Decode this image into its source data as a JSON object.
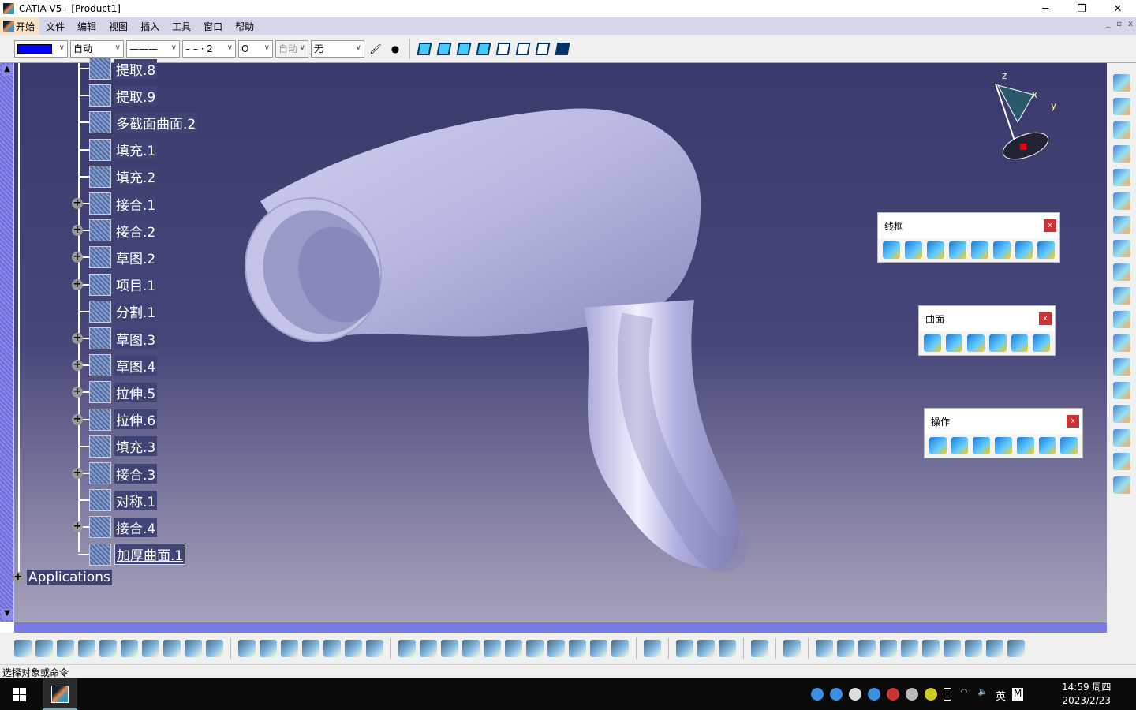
{
  "window": {
    "title": "CATIA V5 - [Product1]",
    "minimize": "─",
    "restore": "❐",
    "close": "✕"
  },
  "menu": {
    "items": [
      "开始",
      "文件",
      "编辑",
      "视图",
      "插入",
      "工具",
      "窗口",
      "帮助"
    ],
    "mdi": [
      "_",
      "▫",
      "x"
    ]
  },
  "toolbar": {
    "color": "#0000ff",
    "transparency": "自动",
    "linetype": "———",
    "lineweight": "– – · 2",
    "point": "O",
    "layer_auto": "自动",
    "layer": "无"
  },
  "tree": {
    "items": [
      {
        "label": "提取.8",
        "expand": false
      },
      {
        "label": "提取.9",
        "expand": false
      },
      {
        "label": "多截面曲面.2",
        "expand": false
      },
      {
        "label": "填充.1",
        "expand": false
      },
      {
        "label": "填充.2",
        "expand": false
      },
      {
        "label": "接合.1",
        "expand": true
      },
      {
        "label": "接合.2",
        "expand": true
      },
      {
        "label": "草图.2",
        "expand": true
      },
      {
        "label": "项目.1",
        "expand": true
      },
      {
        "label": "分割.1",
        "expand": false
      },
      {
        "label": "草图.3",
        "expand": true
      },
      {
        "label": "草图.4",
        "expand": true
      },
      {
        "label": "拉伸.5",
        "expand": true
      },
      {
        "label": "拉伸.6",
        "expand": true
      },
      {
        "label": "填充.3",
        "expand": false
      },
      {
        "label": "接合.3",
        "expand": true
      },
      {
        "label": "对称.1",
        "expand": false
      },
      {
        "label": "接合.4",
        "expand": true
      },
      {
        "label": "加厚曲面.1",
        "expand": false,
        "selected": true
      }
    ],
    "applications": "Applications"
  },
  "panels": {
    "wireframe": {
      "title": "线框",
      "close": "x"
    },
    "surface": {
      "title": "曲面",
      "close": "x"
    },
    "operation": {
      "title": "操作",
      "close": "x"
    }
  },
  "compass": {
    "z": "z",
    "x": "x",
    "y": "y"
  },
  "status": {
    "text": "选择对象或命令"
  },
  "taskbar": {
    "ime": "英",
    "ime2": "M",
    "time": "14:59 周四",
    "date": "2023/2/23"
  }
}
